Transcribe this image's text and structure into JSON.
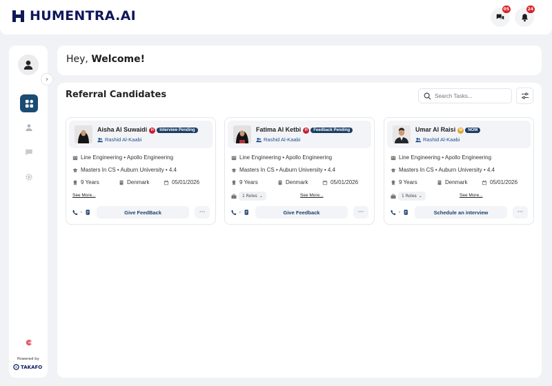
{
  "app": {
    "logo_text": "HUMENTRA.AI"
  },
  "header": {
    "messages_badge": "05",
    "notifications_badge": "24"
  },
  "sidebar": {
    "powered_by": "Powered by",
    "powered_logo": "TAKAFO"
  },
  "welcome": {
    "greeting": "Hey,",
    "highlight": "Welcome!"
  },
  "main": {
    "title": "Referral Candidates",
    "search_placeholder": "Search Tasks..."
  },
  "cards": [
    {
      "name": "Aisha Al Suwaidi",
      "badge": "H",
      "status": "Interview Pending",
      "referrer": "Rashid Al-Kaabi",
      "company_line": "Line Engineering • Apollo Engineering",
      "education_line": "Masters In CS • Auburn University • 4.4",
      "experience": "9 Years",
      "location": "Denmark",
      "date": "05/01/2026",
      "roles": "",
      "see_more": "See More...",
      "action": "Give FeedBack"
    },
    {
      "name": "Fatima Al Ketbi",
      "badge": "H",
      "status": "Feedback Pending",
      "referrer": "Rashid Al-Kaabi",
      "company_line": "Line Engineering • Apollo Engineering",
      "education_line": "Masters In CS • Auburn University • 4.4",
      "experience": "9 Years",
      "location": "Denmark",
      "date": "05/01/2026",
      "roles": "1 Roles",
      "see_more": "See More...",
      "action": "Give Feedback"
    },
    {
      "name": "Umar Al Raisi",
      "badge": "M",
      "status": "NOM",
      "referrer": "Rashid Al-Kaabi",
      "company_line": "Line Engineering • Apollo Engineering",
      "education_line": "Masters In CS • Auburn University • 4.4",
      "experience": "9 Years",
      "location": "Denmark",
      "date": "05/01/2026",
      "roles": "1 Roles",
      "see_more": "See More...",
      "action": "Schedule an interview"
    }
  ]
}
